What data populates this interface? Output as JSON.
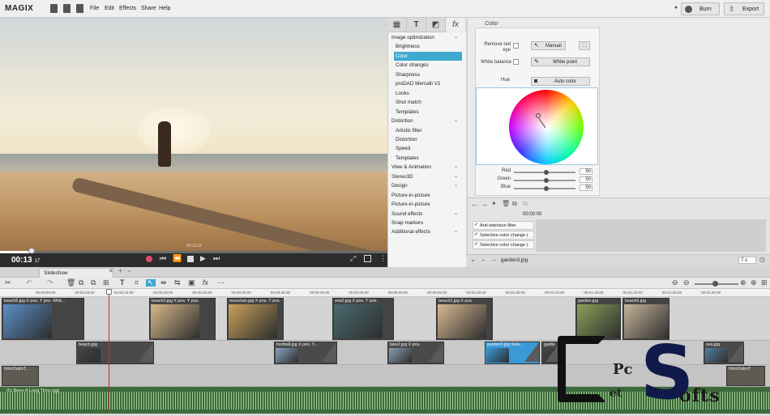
{
  "app": {
    "logo": "MAGIX"
  },
  "menu": [
    "File",
    "Edit",
    "Effects",
    "Share",
    "Help"
  ],
  "toolbar_right": {
    "burn": "Burn",
    "export": "Export"
  },
  "preview": {
    "timecode": "00:13",
    "timecode_frames": "17",
    "scrub_label": "00:13:11",
    "progress": 0.08
  },
  "fx_tabs": [
    "grid-icon",
    "text-icon",
    "contrast-icon",
    "fx-icon"
  ],
  "fx_list": [
    {
      "label": "Image optimization",
      "type": "cat",
      "caret": "⌄"
    },
    {
      "label": "Brightness",
      "type": "item"
    },
    {
      "label": "Color",
      "type": "item",
      "selected": true
    },
    {
      "label": "Color changes",
      "type": "item"
    },
    {
      "label": "Sharpness",
      "type": "item"
    },
    {
      "label": "proDAD Mercalli V2",
      "type": "item"
    },
    {
      "label": "Looks",
      "type": "item"
    },
    {
      "label": "Shot match",
      "type": "item"
    },
    {
      "label": "Templates",
      "type": "item"
    },
    {
      "label": "Distortion",
      "type": "cat",
      "caret": "⌄"
    },
    {
      "label": "Artistic filter",
      "type": "item"
    },
    {
      "label": "Distortion",
      "type": "item"
    },
    {
      "label": "Speed",
      "type": "item"
    },
    {
      "label": "Templates",
      "type": "item"
    },
    {
      "label": "View & Animation",
      "type": "cat",
      "caret": "⌄"
    },
    {
      "label": "Stereo3D",
      "type": "cat",
      "caret": "⌄"
    },
    {
      "label": "Design",
      "type": "cat",
      "caret": "⌄"
    },
    {
      "label": "Picture-in-picture",
      "type": "cat"
    },
    {
      "label": "Picture-in-picture",
      "type": "cat"
    },
    {
      "label": "Sound effects",
      "type": "cat",
      "caret": "⌄"
    },
    {
      "label": "Snap markers",
      "type": "cat"
    },
    {
      "label": "Additional effects",
      "type": "cat",
      "caret": "⌄"
    }
  ],
  "color_panel": {
    "title": "Color",
    "remove_red_eye": "Remove red eye",
    "manual": "Manual",
    "white_balance": "White balance",
    "white_point": "White point",
    "hue": "Hue",
    "auto_color": "Auto color",
    "rgb": [
      {
        "name": "Red",
        "value": "50"
      },
      {
        "name": "Green",
        "value": "50"
      },
      {
        "name": "Blue",
        "value": "50"
      }
    ]
  },
  "keyframes": {
    "time": "00:00:00",
    "rows": [
      "Anti-interlace filter",
      "Selective color change (",
      "Selective color change ("
    ],
    "file": "garden3.jpg",
    "field": "7 s"
  },
  "timeline": {
    "tab": "Slideshow",
    "ruler": [
      "00:00:05:00",
      "00:00:10:00",
      "00:00:15:00",
      "00:00:20:00",
      "00:00:25:00",
      "00:00:30:00",
      "00:00:35:00",
      "00:00:40:00",
      "00:00:45:00",
      "00:00:50:00",
      "00:00:55:00",
      "00:01:00:00",
      "00:01:05:00",
      "00:01:10:00",
      "00:01:15:00",
      "00:01:20:00",
      "00:01:25:00",
      "00:01:30:00"
    ],
    "track1": [
      {
        "t": "beach5.jpg  X pos.  Y pos.  Widt...",
        "c": "#5b8fc8"
      },
      {
        "t": "beach3.jpg  X pos.  Y pos.",
        "c": "#d9b98a"
      },
      {
        "t": "mountain.jpg  X pos.  Y pos.",
        "c": "#c9a05a"
      },
      {
        "t": "sea2.jpg  X pos.  Y pos.",
        "c": "#4a6b70"
      },
      {
        "t": "beach2.jpg  X pos.",
        "c": "#d8b890"
      },
      {
        "t": "garden.jpg",
        "c": "#8aa05a"
      },
      {
        "t": "beach6.jpg",
        "c": "#c6b49a"
      }
    ],
    "track2": [
      {
        "t": "beach.jpg",
        "c": "#444"
      },
      {
        "t": "football.jpg  X pos.  Y...",
        "c": "#8aa2c0"
      },
      {
        "t": "lake2.jpg  X pos.",
        "c": "#8a9fb2"
      },
      {
        "t": "garden3.jpg  Sele...",
        "c": "#3b9ad6"
      },
      {
        "t": "garde",
        "c": "#444"
      },
      {
        "t": "sea.jpg",
        "c": "#4e7fa0"
      }
    ],
    "intro_left": "IntroOutroT...",
    "intro_right": "IntroOutroT",
    "audio": "It's Been A Long Time.ogg"
  },
  "watermark": {
    "pc": "Pc",
    "et": "et",
    "softs": "ofts"
  }
}
